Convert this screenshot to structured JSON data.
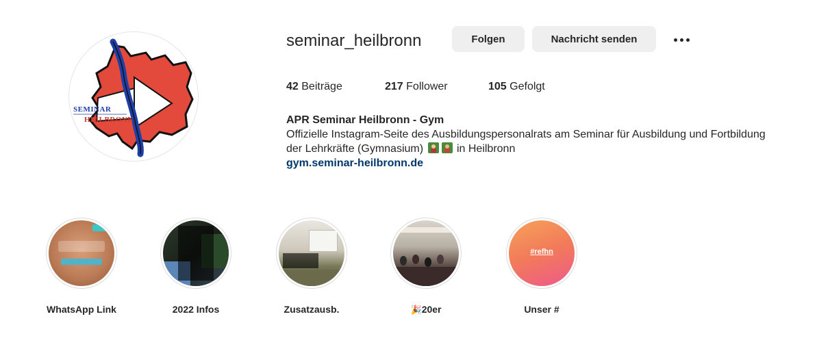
{
  "profile": {
    "username": "seminar_heilbronn",
    "follow_label": "Folgen",
    "message_label": "Nachricht senden",
    "more_icon": "more-horizontal-icon",
    "avatar_logo_text_line1": "Seminar",
    "avatar_logo_text_line2": "Heilbronn"
  },
  "stats": {
    "posts_count": "42",
    "posts_label": "Beiträge",
    "followers_count": "217",
    "followers_label": "Follower",
    "following_count": "105",
    "following_label": "Gefolgt"
  },
  "bio": {
    "name": "APR Seminar Heilbronn - Gym",
    "line1": "Offizielle Instagram-Seite des Ausbildungspersonalrats am Seminar für Ausbildung und Fortbildung",
    "line2_start": "der Lehrkräfte (Gymnasium)",
    "line2_end": "in Heilbronn",
    "link": "gym.seminar-heilbronn.de"
  },
  "highlights": [
    {
      "label": "WhatsApp Link"
    },
    {
      "label": "2022 Infos"
    },
    {
      "label": "Zusatzausb."
    },
    {
      "label": "20er",
      "label_icon": "party-popper-icon"
    },
    {
      "label": "Unser #",
      "cover_text": "#refhn"
    }
  ],
  "colors": {
    "button_bg": "#efefef",
    "link": "#00376b",
    "text": "#262626",
    "logo_red": "#e34a3c",
    "logo_blue": "#1f3fa8",
    "gradient_start": "#f58a5a",
    "gradient_end": "#ee5a8a"
  }
}
